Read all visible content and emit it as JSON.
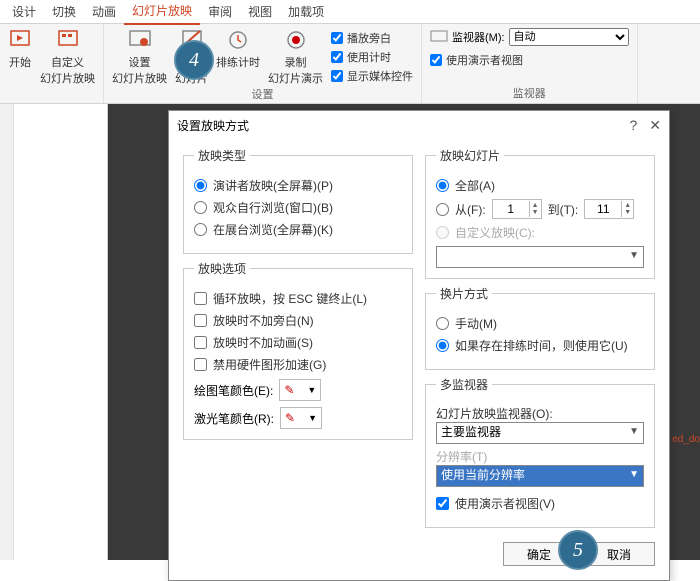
{
  "tabs": [
    "设计",
    "切换",
    "动画",
    "幻灯片放映",
    "审阅",
    "视图",
    "加载项"
  ],
  "active_tab_index": 3,
  "ribbon": {
    "btn_start": "开始",
    "btn_custom": "自定义\n幻灯片放映",
    "btn_setup": "设置\n幻灯片放映",
    "btn_hide": "隐藏\n幻灯片",
    "btn_time": "排练计时",
    "btn_record": "录制\n幻灯片演示",
    "chk_narration": "播放旁白",
    "chk_timing": "使用计时",
    "chk_media": "显示媒体控件",
    "group_setup": "设置",
    "monitor_lbl": "监视器(M):",
    "monitor_val": "自动",
    "chk_presenter": "使用演示者视图",
    "group_monitor": "监视器"
  },
  "dialog": {
    "title": "设置放映方式",
    "type": {
      "legend": "放映类型",
      "r1": "演讲者放映(全屏幕)(P)",
      "r2": "观众自行浏览(窗口)(B)",
      "r3": "在展台浏览(全屏幕)(K)"
    },
    "options": {
      "legend": "放映选项",
      "c1": "循环放映，按 ESC 键终止(L)",
      "c2": "放映时不加旁白(N)",
      "c3": "放映时不加动画(S)",
      "c4": "禁用硬件图形加速(G)",
      "pen": "绘图笔颜色(E):",
      "laser": "激光笔颜色(R):"
    },
    "slides": {
      "legend": "放映幻灯片",
      "all": "全部(A)",
      "from": "从(F):",
      "from_v": "1",
      "to": "到(T):",
      "to_v": "11",
      "custom": "自定义放映(C):"
    },
    "advance": {
      "legend": "换片方式",
      "manual": "手动(M)",
      "timing": "如果存在排练时间，则使用它(U)"
    },
    "multi": {
      "legend": "多监视器",
      "mon_lbl": "幻灯片放映监视器(O):",
      "mon_val": "主要监视器",
      "res_lbl": "分辨率(T)",
      "res_val": "使用当前分辨率",
      "presenter": "使用演示者视图(V)"
    },
    "ok": "确定",
    "cancel": "取消"
  },
  "badges": {
    "b4": "4",
    "b5": "5"
  },
  "red_tag": "ed_do"
}
